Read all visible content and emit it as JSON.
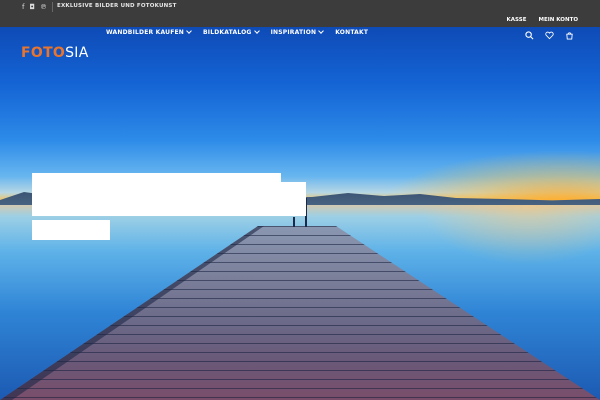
{
  "topbar": {
    "social_icons": [
      "facebook-icon",
      "instagram-icon",
      "pinterest-icon"
    ],
    "social_glyphs": [
      "f",
      "◘",
      "℗"
    ],
    "tagline": "EXKLUSIVE BILDER UND FOTOKUNST",
    "links": [
      "KASSE",
      "MEIN KONTO"
    ]
  },
  "header": {
    "logo_part1": "FOTO",
    "logo_part2": "SIA",
    "nav": [
      {
        "label": "WANDBILDER KAUFEN",
        "has_dropdown": true
      },
      {
        "label": "BILDKATALOG",
        "has_dropdown": true
      },
      {
        "label": "INSPIRATION",
        "has_dropdown": true
      },
      {
        "label": "KONTAKT",
        "has_dropdown": false
      }
    ],
    "icons": [
      "search-icon",
      "heart-icon",
      "cart-icon"
    ]
  },
  "colors": {
    "topbar_bg": "#3c3c3c",
    "logo_accent": "#e8742d",
    "text_light": "#ffffff"
  }
}
